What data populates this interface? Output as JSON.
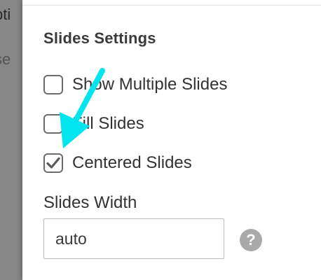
{
  "background_page": {
    "text_1": "pti",
    "text_2": "se"
  },
  "slides_settings": {
    "title": "Slides Settings",
    "options": [
      {
        "label": "Show Multiple Slides",
        "checked": false
      },
      {
        "label": "Fill Slides",
        "checked": false
      },
      {
        "label": "Centered Slides",
        "checked": true
      }
    ],
    "width_field": {
      "label": "Slides Width",
      "value": "auto"
    },
    "help_icon_glyph": "?"
  },
  "colors": {
    "annotation_arrow": "#00e5ee",
    "checkmark": "#5a5a5a"
  },
  "annotation": {
    "icon": "arrow-annotation-icon",
    "points_to": "Centered Slides"
  }
}
